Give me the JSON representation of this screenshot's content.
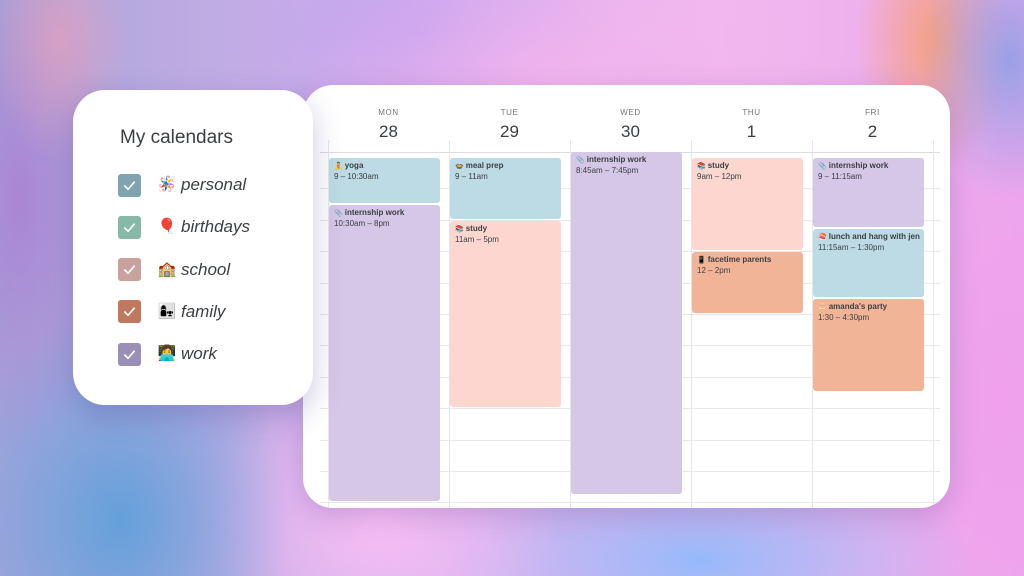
{
  "sidebar": {
    "title": "My calendars",
    "calendars": [
      {
        "label": "personal",
        "emoji": "🪅",
        "color": "#7fa3b0",
        "checked": true
      },
      {
        "label": "birthdays",
        "emoji": "🎈",
        "color": "#86b9a8",
        "checked": true
      },
      {
        "label": "school",
        "emoji": "🏫",
        "color": "#c9a29d",
        "checked": true
      },
      {
        "label": "family",
        "emoji": "👩‍👧",
        "color": "#c0795e",
        "checked": true
      },
      {
        "label": "work",
        "emoji": "👩‍💻",
        "color": "#9a8fb6",
        "checked": true
      }
    ]
  },
  "calendar": {
    "visible_hours": {
      "first": 9,
      "last": 20
    },
    "event_colors": {
      "blue": "#bddbe5",
      "purple": "#d5c7e6",
      "pink": "#fdd6d0",
      "orange": "#f2b497"
    },
    "days": [
      {
        "dow": "MON",
        "date": "28",
        "events": [
          {
            "emoji": "🧘",
            "title": "yoga",
            "time": "9 – 10:30am",
            "start": 9,
            "end": 10.5,
            "color": "blue"
          },
          {
            "emoji": "📎",
            "title": "internship work",
            "time": "10:30am – 8pm",
            "start": 10.5,
            "end": 20,
            "color": "purple"
          }
        ]
      },
      {
        "dow": "TUE",
        "date": "29",
        "events": [
          {
            "emoji": "🍲",
            "title": "meal prep",
            "time": "9 – 11am",
            "start": 9,
            "end": 11,
            "color": "blue"
          },
          {
            "emoji": "📚",
            "title": "study",
            "time": "11am – 5pm",
            "start": 11,
            "end": 17,
            "color": "pink"
          }
        ]
      },
      {
        "dow": "WED",
        "date": "30",
        "events": [
          {
            "emoji": "📎",
            "title": "internship work",
            "time": "8:45am – 7:45pm",
            "start": 8.75,
            "end": 19.75,
            "color": "purple"
          }
        ]
      },
      {
        "dow": "THU",
        "date": "1",
        "events": [
          {
            "emoji": "📚",
            "title": "study",
            "time": "9am – 12pm",
            "start": 9,
            "end": 12,
            "color": "pink"
          },
          {
            "emoji": "📱",
            "title": "facetime parents",
            "time": "12 – 2pm",
            "start": 12,
            "end": 14,
            "color": "orange"
          }
        ]
      },
      {
        "dow": "FRI",
        "date": "2",
        "events": [
          {
            "emoji": "📎",
            "title": "internship work",
            "time": "9 – 11:15am",
            "start": 9,
            "end": 11.25,
            "color": "purple"
          },
          {
            "emoji": "🍣",
            "title": "lunch and hang with jen",
            "time": "11:15am – 1:30pm",
            "start": 11.25,
            "end": 13.5,
            "color": "blue"
          },
          {
            "emoji": "🎂",
            "title": "amanda's party",
            "time": "1:30 – 4:30pm",
            "start": 13.5,
            "end": 16.5,
            "color": "orange"
          }
        ]
      }
    ]
  }
}
